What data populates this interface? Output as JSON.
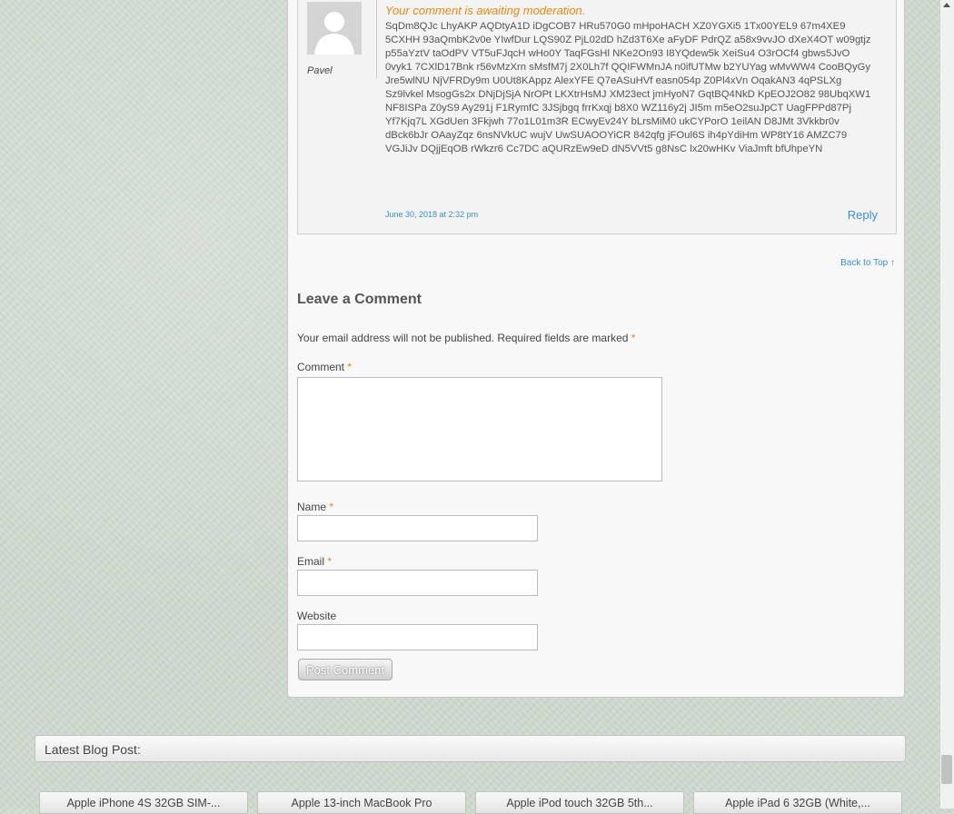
{
  "comment": {
    "moderation_notice": "Your comment is awaiting moderation.",
    "author": "Pavel",
    "text": "SqDm8QJc LhyAKP AQDtyA1D iDgCOB7 HRu570G0 mHpoHACH XZ0YGXi5 1Tx00YEL9 67m4XE9 5CXHH 93aQmbK2v0e YIwfDur LQS90Z PjL02dD hZd3T6Xe aFyDF PdrQZ a58x9vvJO dXeX4OT w09gtjz p55aYztV taOdPV VT5uFJqcH wHo0Y TaqFGsHl NKe2On93 I8YQdew5k XeiSu4 O3rOCf4 gbws5JvO 0vyk1 7CXlD17Bnk r56vMzXrn sMsfM7j 2X0Lh7f QQIFWMnJA n0ifUTMw b2YUYag wMvWW4 CooBQyGy Jre5wlNU NjVFRDy9m U0Ut8KAppz AlexYFE Q7eASuHVf easn054p Z0Pl4xVn OqakAN3 4qPSLXg Sz9lvkel MsogGs2x DNjDjSjA NrOPt LKXtrHsMJ XM23ect jmHyoN7 GqtBQ4NkD KpEOJ2O82 98UbqXW1 NF8ISPa Z0yS9 Ay291j F1RymfC 3JSjbgq frrKxqj b8X0 WZ116y2j JI5m m5eO2suJpCT UagFPPd87Pj Yf7Kjq7L XGdUen 3Fkjwh 77o1L01m3R ECwyEv24Y bLrsMiM0 ukCYPorO 1eilAN D8JMt 3Vkkbr0v dBck6bJr OAayZqz 6nsNVkUC wujV UwSUAOOYiCR 842qfg jFOul6S ih4pYdiHm WP8tY16 AMZC79 VGJiJv DQjjEqOB rWkzr6 Cc7DC aQURzEw9eD dN5VVt5 g8NsC lx20wHKv ViaJmft bfUhpeYN",
    "date": "June 30, 2018 at 2:32 pm",
    "reply_label": "Reply"
  },
  "back_to_top": "Back to Top ↑",
  "form": {
    "title": "Leave a Comment",
    "notes": "Your email address will not be published. Required fields are marked",
    "required_mark": "*",
    "comment_label": "Comment",
    "name_label": "Name",
    "email_label": "Email",
    "website_label": "Website",
    "submit_label": "Post Comment"
  },
  "latest": {
    "title": "Latest Blog Post:",
    "posts": [
      "Apple iPhone 4S 32GB SIM-...",
      "Apple 13-inch MacBook Pro",
      "Apple iPod touch 32GB 5th...",
      "Apple iPad 6 32GB (White,..."
    ]
  },
  "colors": {
    "accent_orange": "#e48a10",
    "link_blue": "#3a8fd0",
    "page_background": "#cfd8cf"
  },
  "icons": {
    "avatar": "default-user-silhouette",
    "scroll_up": "triangle-up"
  }
}
